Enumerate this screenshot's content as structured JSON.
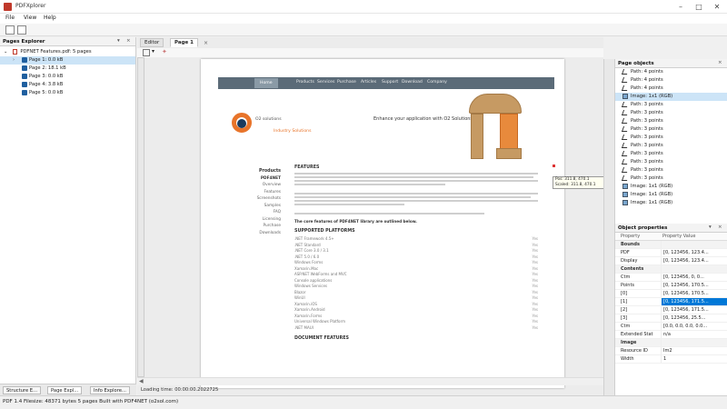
{
  "window": {
    "title": "PDFXplorer"
  },
  "menu": [
    "File",
    "View",
    "Help"
  ],
  "left_pane": {
    "title": "Pages Explorer",
    "root": "PDFNET Features.pdf: 5 pages",
    "pages": [
      "Page 1: 0.0 kB",
      "Page 2: 18.1 kB",
      "Page 3: 0.0 kB",
      "Page 4: 3.8 kB",
      "Page 5: 0.0 kB"
    ],
    "tabs": [
      "Structure E...",
      "Page Expl...",
      "Info Explore..."
    ]
  },
  "center": {
    "tabs": [
      "Editor",
      "Page 1"
    ],
    "loading": "Loading time: 00:00:00.2022725"
  },
  "site": {
    "nav": [
      "Home",
      "Products",
      "Services",
      "Purchase",
      "Articles",
      "Support",
      "Download",
      "Company"
    ],
    "logo_text": "O2 solutions",
    "logo_sub": "Industry Solutions",
    "tagline": "Enhance your application with O2 Solutions",
    "sidenav": [
      "Products",
      "PDF4NET",
      "Overview",
      "Features",
      "Screenshots",
      "Samples",
      "FAQ",
      "Licensing",
      "Purchase",
      "Downloads"
    ],
    "heading1": "FEATURES",
    "para_text": "The core features of PDF4NET library are outlined below.",
    "heading2": "SUPPORTED PLATFORMS",
    "platforms": [
      ".NET Framework 4.5+",
      ".NET Standard",
      ".NET Core 3.0 / 3.1",
      ".NET 5.0 / 6.0",
      "Windows Forms",
      "Xamarin.Mac",
      "ASP.NET WebForms and MVC",
      "Console applications",
      "Windows Services",
      "Blazor",
      "WinUI",
      "Xamarin.iOS",
      "Xamarin.Android",
      "Xamarin.Forms",
      "Universal Windows Platform",
      ".NET MAUI"
    ],
    "yes_label": "Yes",
    "heading3": "DOCUMENT FEATURES"
  },
  "tooltip": {
    "line1": "Pos: 311.8, 470.1",
    "line2": "Scaled: 311.8, 470.1"
  },
  "objects_pane": {
    "title": "Page objects",
    "items": [
      {
        "kind": "path",
        "label": "Path: 4 points"
      },
      {
        "kind": "path",
        "label": "Path: 4 points"
      },
      {
        "kind": "path",
        "label": "Path: 4 points"
      },
      {
        "kind": "image",
        "label": "Image: 1x1 (RGB)",
        "selected": true
      },
      {
        "kind": "path",
        "label": "Path: 3 points"
      },
      {
        "kind": "path",
        "label": "Path: 3 points"
      },
      {
        "kind": "path",
        "label": "Path: 3 points"
      },
      {
        "kind": "path",
        "label": "Path: 3 points"
      },
      {
        "kind": "path",
        "label": "Path: 3 points"
      },
      {
        "kind": "path",
        "label": "Path: 3 points"
      },
      {
        "kind": "path",
        "label": "Path: 3 points"
      },
      {
        "kind": "path",
        "label": "Path: 3 points"
      },
      {
        "kind": "path",
        "label": "Path: 3 points"
      },
      {
        "kind": "path",
        "label": "Path: 3 points"
      },
      {
        "kind": "image",
        "label": "Image: 1x1 (RGB)"
      },
      {
        "kind": "image",
        "label": "Image: 1x1 (RGB)"
      },
      {
        "kind": "image",
        "label": "Image: 1x1 (RGB)"
      }
    ]
  },
  "props_pane": {
    "title": "Object properties",
    "col_name": "Property",
    "col_value": "Property Value",
    "rows": [
      {
        "cat": true,
        "n": "Bounds",
        "v": ""
      },
      {
        "n": "PDF",
        "v": "[0, 123456, 123.4..."
      },
      {
        "n": "Display",
        "v": "[0, 123456, 123.4..."
      },
      {
        "cat": true,
        "n": "Contents",
        "v": ""
      },
      {
        "n": "Ctm",
        "v": "[0, 123456, 0, 0..."
      },
      {
        "n": "Points",
        "v": "[0, 123456, 170.5..."
      },
      {
        "n": "[0]",
        "v": "[0, 123456, 170.5..."
      },
      {
        "n": "[1]",
        "v": "[0, 123456, 171.5...",
        "selected": true
      },
      {
        "n": "[2]",
        "v": "[0, 123456, 171.5..."
      },
      {
        "n": "[3]",
        "v": "[0, 123456, 25.5..."
      },
      {
        "n": "Ctm",
        "v": "[0.0, 0.0, 0.0, 0.0..."
      },
      {
        "n": "Extended Stat",
        "v": "n/a"
      },
      {
        "cat": true,
        "n": "Image",
        "v": ""
      },
      {
        "n": "Resource ID",
        "v": "Im2"
      },
      {
        "n": "Width",
        "v": "1"
      }
    ]
  },
  "statusbar": "PDF 1.4   Filesize: 48371 bytes   5 pages   Built with PDF4NET (o2sol.com)"
}
